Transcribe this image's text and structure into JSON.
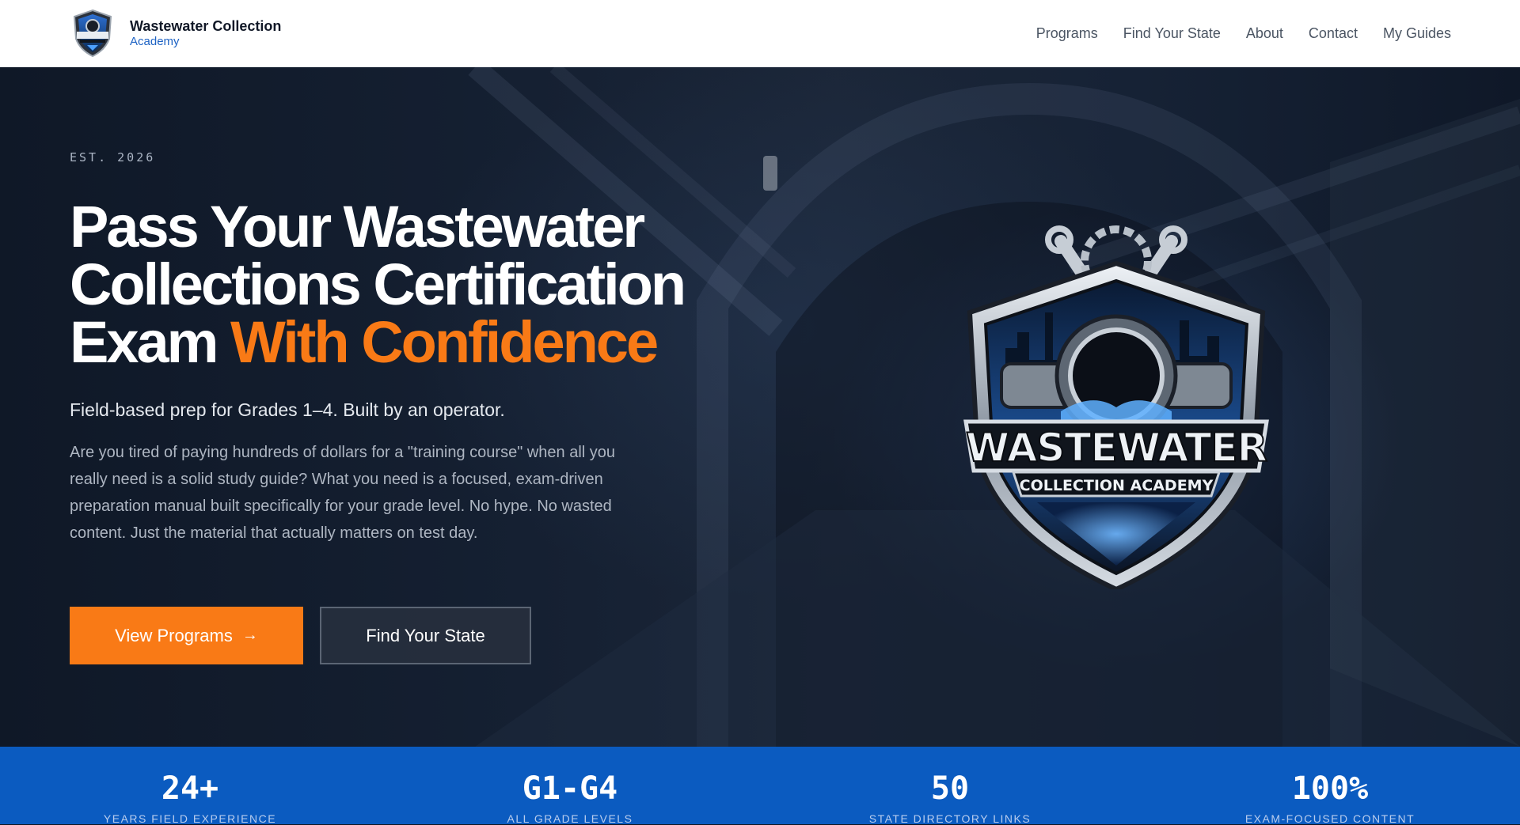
{
  "brand": {
    "name": "Wastewater Collection",
    "sub": "Academy",
    "logo_icon": "shield-crest-icon"
  },
  "nav": {
    "items": [
      {
        "label": "Programs"
      },
      {
        "label": "Find Your State"
      },
      {
        "label": "About"
      },
      {
        "label": "Contact"
      },
      {
        "label": "My Guides"
      }
    ]
  },
  "hero": {
    "eyebrow": "EST. 2026",
    "headline_line1": "Pass Your Wastewater",
    "headline_line2": "Collections Certification",
    "headline_line3_prefix": "Exam",
    "headline_accent": "With Confidence",
    "tagline": "Field-based prep for Grades 1–4. Built by an operator.",
    "description": "Are you tired of paying hundreds of dollars for a \"training course\" when all you really need is a solid study guide? What you need is a focused, exam-driven preparation manual built specifically for your grade level. No hype. No wasted content. Just the material that actually matters on test day.",
    "primary_button": "View Programs",
    "primary_button_icon": "arrow-right-icon",
    "secondary_button": "Find Your State",
    "crest": {
      "title": "WASTEWATER",
      "subtitle": "COLLECTION ACADEMY"
    }
  },
  "stats": [
    {
      "value": "24+",
      "label": "YEARS FIELD EXPERIENCE"
    },
    {
      "value": "G1-G4",
      "label": "ALL GRADE LEVELS"
    },
    {
      "value": "50",
      "label": "STATE DIRECTORY LINKS"
    },
    {
      "value": "100%",
      "label": "EXAM-FOCUSED CONTENT"
    }
  ],
  "colors": {
    "accent": "#f97a16",
    "brand_blue": "#0b5bc0",
    "hero_bg": "#152032"
  }
}
